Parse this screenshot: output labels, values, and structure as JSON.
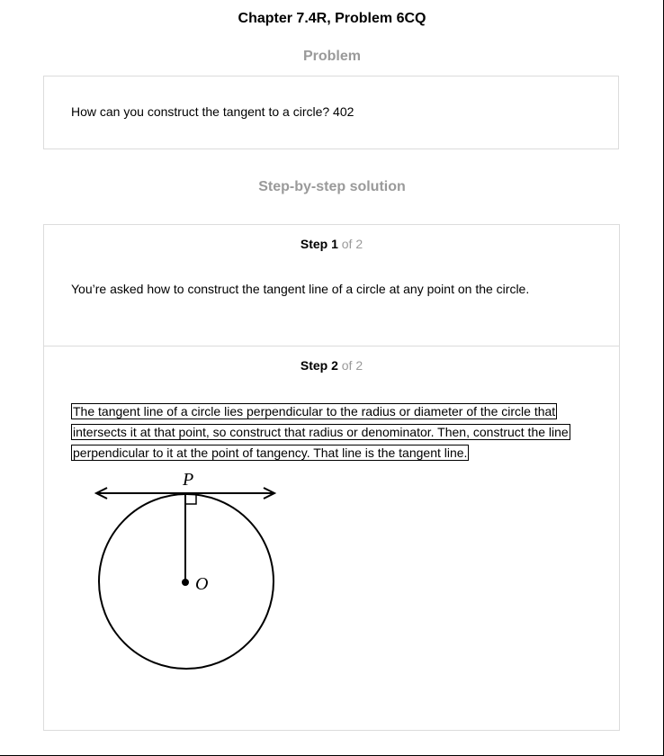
{
  "page": {
    "title": "Chapter 7.4R, Problem 6CQ"
  },
  "problem": {
    "heading": "Problem",
    "text": "How can you construct the tangent to a circle? 402"
  },
  "solution": {
    "heading": "Step-by-step solution",
    "steps": [
      {
        "label": "Step 1",
        "of": " of 2",
        "text": "You’re asked how to construct the tangent line of a circle at any point on the circle."
      },
      {
        "label": "Step 2",
        "of": " of 2",
        "text": "The tangent line of a circle lies perpendicular to the radius or diameter of the circle that intersects it at that point, so construct that radius or denominator. Then, construct the line perpendicular to it at the point of tangency. That line is the tangent line."
      }
    ]
  },
  "diagram": {
    "point_p_label": "P",
    "point_o_label": "O"
  }
}
